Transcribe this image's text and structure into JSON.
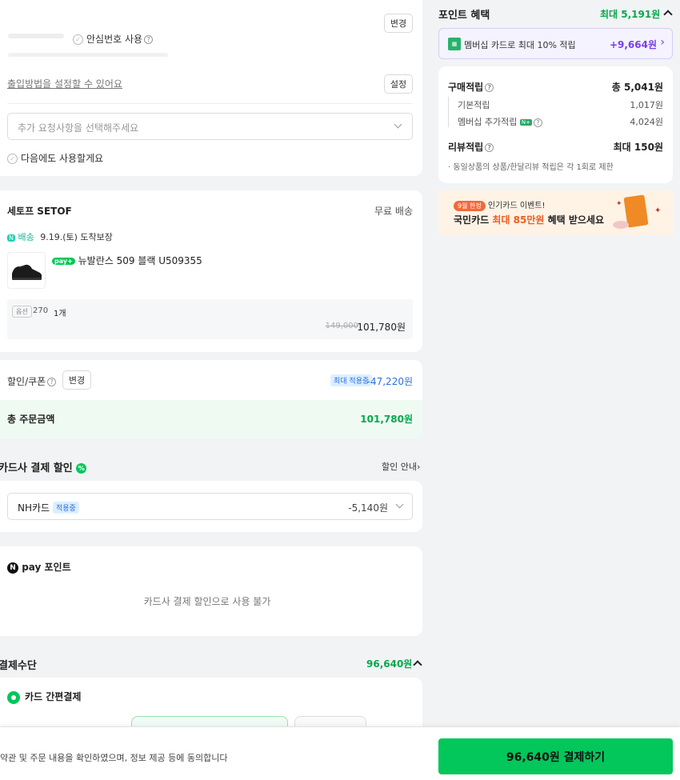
{
  "address": {
    "change_label": "변경",
    "safe_number_label": "안심번호 사용",
    "entry_method_text": "출입방법을 설정할 수 있어요",
    "set_label": "설정",
    "request_placeholder": "추가 요청사항을 선택해주세요",
    "remember_label": "다음에도 사용할게요"
  },
  "seller": {
    "name": "세토프 SETOF",
    "shipping": "무료 배송",
    "delivery_tag": "배송",
    "delivery_date": "9.19.(토) 도착보장",
    "product_badge": "pay+",
    "product_name": "뉴발란스 509 블랙 U509355",
    "option_label": "옵션",
    "option_value": "270",
    "quantity": "1개",
    "original_price": "149,000",
    "price": "101,780원"
  },
  "discount": {
    "label": "할인/쿠폰",
    "change_label": "변경",
    "applied_badge": "최대 적용중",
    "amount": "-47,220원",
    "total_label": "총 주문금액",
    "total_value": "101,780원"
  },
  "card_discount": {
    "title": "카드사 결제 할인",
    "guide_label": "할인 안내",
    "card_name": "NH카드",
    "applied_badge": "적용중",
    "amount": "-5,140원"
  },
  "npay_point": {
    "logo_n": "N",
    "title": "pay 포인트",
    "message": "카드사 결제 할인으로 사용 불가"
  },
  "payment": {
    "title": "결제수단",
    "amount": "96,640원",
    "method_label": "카드 간편결제"
  },
  "footer": {
    "agree_text": "약관 및 주문 내용을 확인하였으며, 정보 제공 등에 동의합니다",
    "pay_button": "96,640원 결제하기"
  },
  "points": {
    "title": "포인트 혜택",
    "max_label": "최대 5,191원",
    "membership_text": "멤버십 카드로 최대 10% 적립",
    "membership_amount": "+9,664원",
    "purchase_label": "구매적립",
    "purchase_total": "총 5,041원",
    "basic_label": "기본적립",
    "basic_value": "1,017원",
    "member_label": "멤버십 추가적립",
    "member_value": "4,024원",
    "review_label": "리뷰적립",
    "review_value": "최대 150원",
    "review_note": "· 동일상품의 상품/한달리뷰 적립은 각 1회로 제한"
  },
  "banner": {
    "tag": "9월 한정",
    "headline": "인기카드 이벤트!",
    "text_pre": "국민카드",
    "text_highlight": "최대 85만원",
    "text_post": "혜택 받으세요"
  },
  "colors": {
    "accent_green": "#03c75a",
    "price_green": "#03a94d",
    "membership_purple": "#7b3fe4"
  }
}
